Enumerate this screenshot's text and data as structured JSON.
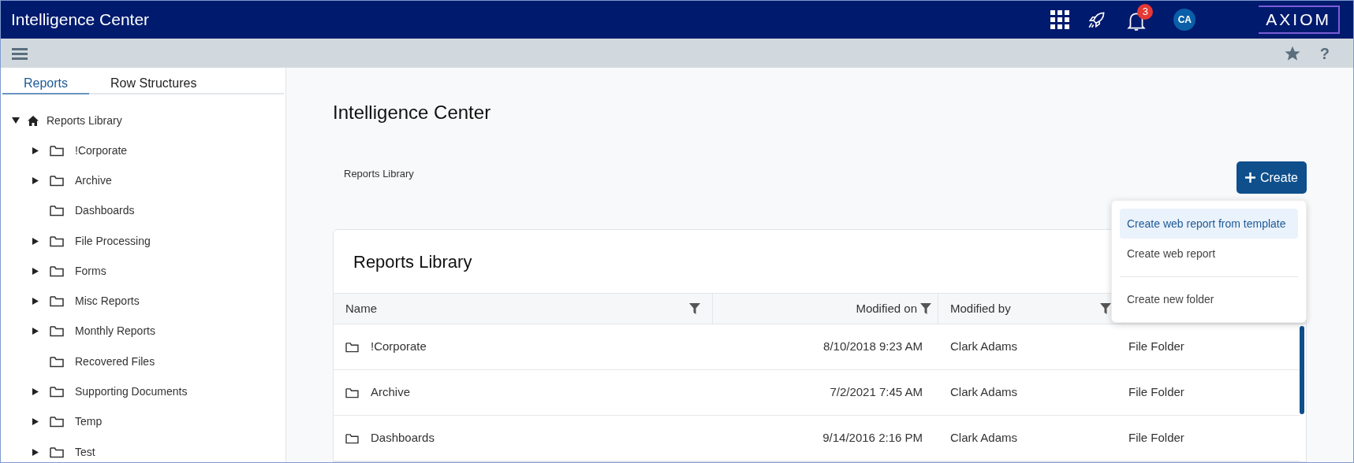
{
  "app_bar": {
    "title": "Intelligence Center",
    "notification_count": "3",
    "avatar": "CA",
    "logo": "AXIOM"
  },
  "toolbar": {
    "help": "?"
  },
  "sidebar": {
    "tabs": [
      {
        "label": "Reports",
        "selected": true
      },
      {
        "label": "Row Structures",
        "selected": false
      }
    ],
    "tree": [
      {
        "label": "Reports Library",
        "expanded": true,
        "children": [
          {
            "label": "!Corporate",
            "expandable": true
          },
          {
            "label": "Archive",
            "expandable": true
          },
          {
            "label": "Dashboards",
            "expandable": false
          },
          {
            "label": "File Processing",
            "expandable": true
          },
          {
            "label": "Forms",
            "expandable": true
          },
          {
            "label": "Misc Reports",
            "expandable": true
          },
          {
            "label": "Monthly Reports",
            "expandable": true
          },
          {
            "label": "Recovered Files",
            "expandable": false
          },
          {
            "label": "Supporting Documents",
            "expandable": true
          },
          {
            "label": "Temp",
            "expandable": true
          },
          {
            "label": "Test",
            "expandable": true
          }
        ]
      }
    ]
  },
  "main": {
    "title": "Intelligence Center",
    "breadcrumb": "Reports Library",
    "create_button": "Create",
    "menu": [
      {
        "label": "Create web report from template",
        "selected": true,
        "divider_before": false
      },
      {
        "label": "Create web report",
        "selected": false,
        "divider_before": false
      },
      {
        "label": "Create new folder",
        "selected": false,
        "divider_before": true
      }
    ],
    "card_title": "Reports Library",
    "table": {
      "columns": [
        "Name",
        "Modified on",
        "Modified by"
      ],
      "rows": [
        {
          "name": "!Corporate",
          "modified_on": "8/10/2018 9:23 AM",
          "modified_by": "Clark Adams",
          "type": "File Folder"
        },
        {
          "name": "Archive",
          "modified_on": "7/2/2021 7:45 AM",
          "modified_by": "Clark Adams",
          "type": "File Folder"
        },
        {
          "name": "Dashboards",
          "modified_on": "9/14/2016 2:16 PM",
          "modified_by": "Clark Adams",
          "type": "File Folder"
        }
      ]
    }
  }
}
